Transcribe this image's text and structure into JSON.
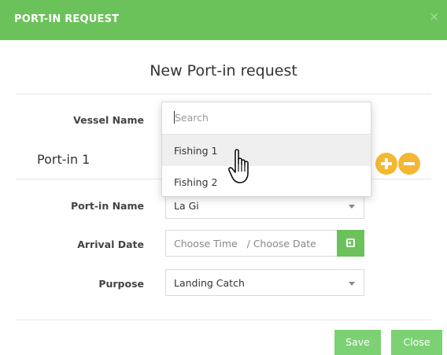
{
  "modal": {
    "title": "PORT-IN REQUEST",
    "close_glyph": "×",
    "subtitle": "New Port-in request"
  },
  "form": {
    "vessel_name_label": "Vessel Name",
    "section_title": "Port-in 1",
    "port_in_name_label": "Port-in Name",
    "port_in_name_value": "La Gi",
    "arrival_date_label": "Arrival Date",
    "arrival_date_placeholder": "Choose Time   / Choose Date",
    "purpose_label": "Purpose",
    "purpose_value": "Landing Catch"
  },
  "dropdown": {
    "search_placeholder": "Search",
    "options": [
      "Fishing 1",
      "Fishing 2"
    ],
    "hovered_option": "Fishing 1"
  },
  "actions": {
    "save_label": "Save",
    "close_label": "Close"
  },
  "icons": {
    "add": "plus-circle-icon",
    "remove": "minus-circle-icon",
    "calendar": "calendar-icon",
    "cursor": "hand-pointer-icon"
  },
  "colors": {
    "header": "#6cc25a",
    "button": "#7cd174",
    "add_remove": "#f4b733"
  }
}
